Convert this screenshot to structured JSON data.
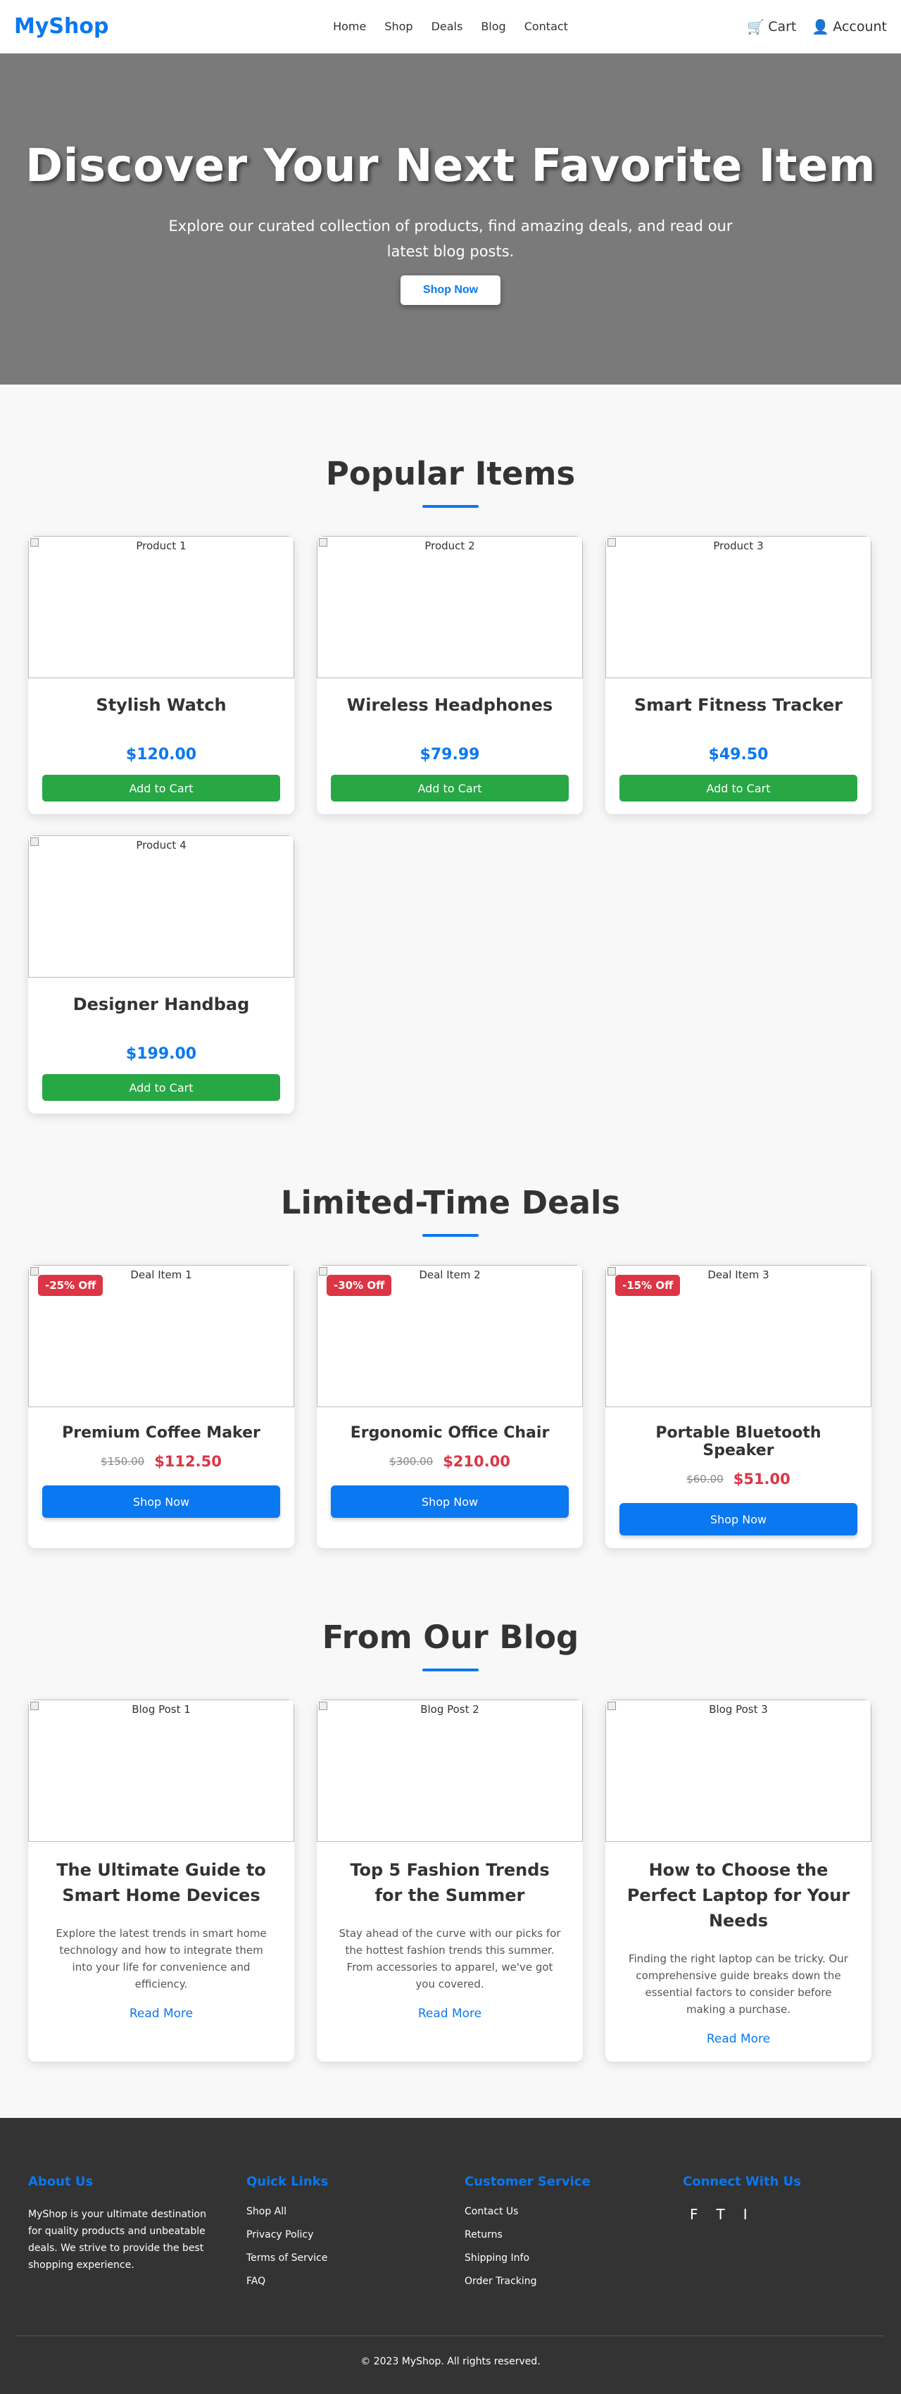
{
  "header": {
    "logo": "MyShop",
    "nav": [
      "Home",
      "Shop",
      "Deals",
      "Blog",
      "Contact"
    ],
    "cart_label": "Cart",
    "cart_icon": "cart-icon",
    "account_label": "Account",
    "account_icon": "user-icon"
  },
  "hero": {
    "title": "Discover Your Next Favorite Item",
    "subtitle": "Explore our curated collection of products, find amazing deals, and read our latest blog posts.",
    "button": "Shop Now"
  },
  "popular": {
    "title": "Popular Items",
    "items": [
      {
        "img_alt": "Product 1",
        "name": "Stylish Watch",
        "price": "$120.00",
        "button": "Add to Cart"
      },
      {
        "img_alt": "Product 2",
        "name": "Wireless Headphones",
        "price": "$79.99",
        "button": "Add to Cart"
      },
      {
        "img_alt": "Product 3",
        "name": "Smart Fitness Tracker",
        "price": "$49.50",
        "button": "Add to Cart"
      },
      {
        "img_alt": "Product 4",
        "name": "Designer Handbag",
        "price": "$199.00",
        "button": "Add to Cart"
      }
    ]
  },
  "deals": {
    "title": "Limited-Time Deals",
    "items": [
      {
        "img_alt": "Deal Item 1",
        "badge": "-25% Off",
        "name": "Premium Coffee Maker",
        "old_price": "$150.00",
        "new_price": "$112.50",
        "button": "Shop Now"
      },
      {
        "img_alt": "Deal Item 2",
        "badge": "-30% Off",
        "name": "Ergonomic Office Chair",
        "old_price": "$300.00",
        "new_price": "$210.00",
        "button": "Shop Now"
      },
      {
        "img_alt": "Deal Item 3",
        "badge": "-15% Off",
        "name": "Portable Bluetooth Speaker",
        "old_price": "$60.00",
        "new_price": "$51.00",
        "button": "Shop Now"
      }
    ]
  },
  "blog": {
    "title": "From Our Blog",
    "posts": [
      {
        "img_alt": "Blog Post 1",
        "title": "The Ultimate Guide to Smart Home Devices",
        "excerpt": "Explore the latest trends in smart home technology and how to integrate them into your life for convenience and efficiency.",
        "link": "Read More"
      },
      {
        "img_alt": "Blog Post 2",
        "title": "Top 5 Fashion Trends for the Summer",
        "excerpt": "Stay ahead of the curve with our picks for the hottest fashion trends this summer. From accessories to apparel, we've got you covered.",
        "link": "Read More"
      },
      {
        "img_alt": "Blog Post 3",
        "title": "How to Choose the Perfect Laptop for Your Needs",
        "excerpt": "Finding the right laptop can be tricky. Our comprehensive guide breaks down the essential factors to consider before making a purchase.",
        "link": "Read More"
      }
    ]
  },
  "footer": {
    "about_title": "About Us",
    "about_text": "MyShop is your ultimate destination for quality products and unbeatable deals. We strive to provide the best shopping experience.",
    "quick_title": "Quick Links",
    "quick_links": [
      "Shop All",
      "Privacy Policy",
      "Terms of Service",
      "FAQ"
    ],
    "service_title": "Customer Service",
    "service_links": [
      "Contact Us",
      "Returns",
      "Shipping Info",
      "Order Tracking"
    ],
    "social_title": "Connect With Us",
    "social": [
      "F",
      "T",
      "I"
    ],
    "copyright": "© 2023 MyShop. All rights reserved."
  },
  "colors": {
    "brand": "#0a78f0",
    "success": "#28a745",
    "danger": "#dc3545",
    "hero_bg": "#7a7a7a",
    "footer_bg": "#333333"
  }
}
